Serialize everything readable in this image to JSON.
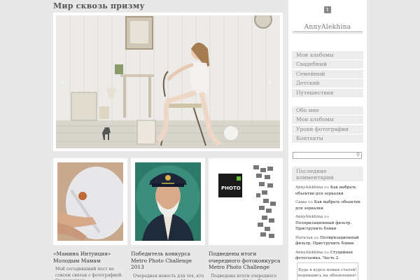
{
  "site": {
    "title": "Мир сквозь призму"
  },
  "slider": {
    "prev_icon": "‹",
    "next_icon": "›"
  },
  "posts": [
    {
      "title": "«Мамина Интуиция» Молодым Мамам",
      "excerpt": "Мой сегодняшний пост не совсем связан с фотографией. Он посвящен"
    },
    {
      "title": "Победитель конкурса Metro Photo Challenge 2013",
      "excerpt": "Очередная новость для тех, кто следит за конкурсом Metro Photo Challenge. А"
    },
    {
      "title": "Подведены итоги очередного фотоконкурса Metro Photo Challenge",
      "excerpt": "Подведены итоги очередного фотоконкурса Metro Photo Challenge"
    }
  ],
  "sidebar": {
    "social_icon": "t",
    "username": "AnnyAlekhina",
    "menu1": [
      "Мои альбомы",
      "Свадебный",
      "Семейный",
      "Детский",
      "Путешествия"
    ],
    "menu2": [
      "Обо мне",
      "Мои альбомы",
      "Уроки фотографии",
      "Контакты"
    ],
    "search_placeholder": "",
    "search_icon": "⚲",
    "recent_header": "Последние комментарии",
    "recent": [
      {
        "author": "AnnyAlekhina",
        "on": " на ",
        "title": "Как выбрать объектив для зеркалки"
      },
      {
        "author": "Саша",
        "on": " на ",
        "title": "Как выбрать объектив для зеркалки"
      },
      {
        "author": "AnnyAlekhina",
        "on": " на ",
        "title": "Поляризационный фильтр. Приструнить блики"
      },
      {
        "author": "Наталья",
        "on": " на ",
        "title": "Поляризационный фильтр. Приструнить блики"
      },
      {
        "author": "AnnyAlekhina",
        "on": " на ",
        "title": "Студийная фотосъемка. Часть 2."
      }
    ],
    "subscribe": "Будь в курсе новых статей! подпишись на обновления!:"
  }
}
